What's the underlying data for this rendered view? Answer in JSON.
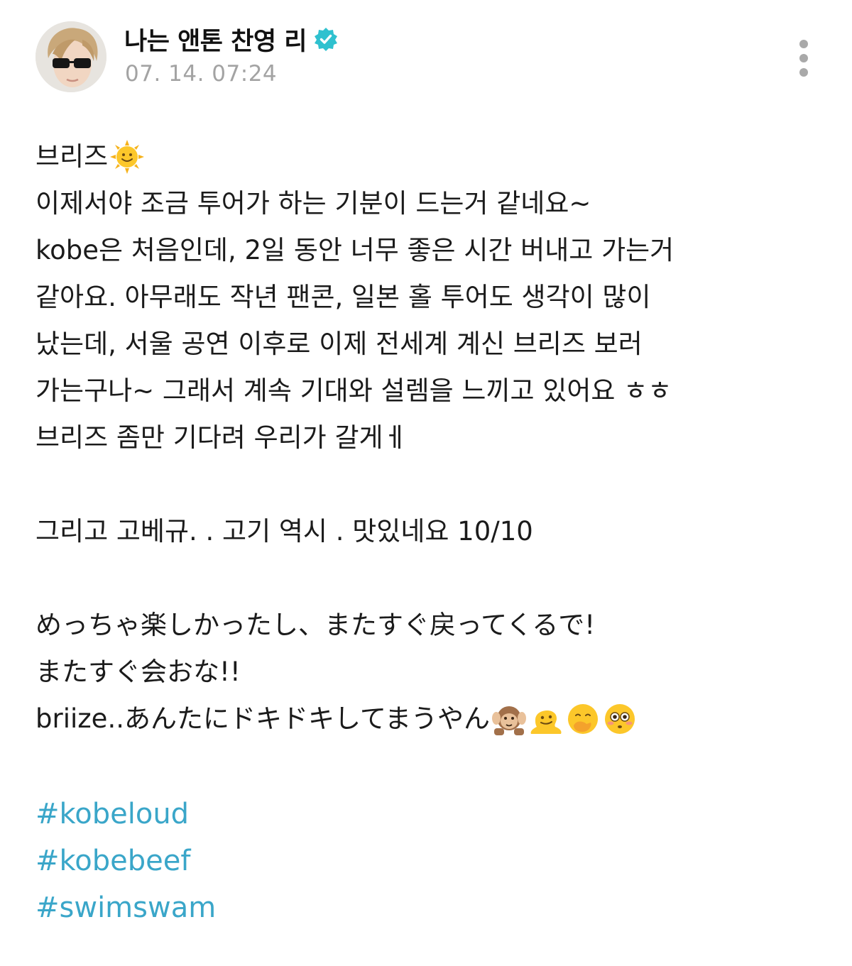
{
  "author": {
    "name": "나는 앤톤 찬영 리",
    "timestamp": "07. 14. 07:24"
  },
  "post": {
    "lines": [
      "브리즈",
      "이제서야 조금 투어가 하는 기분이 드는거 같네요~",
      "kobe은 처음인데, 2일 동안 너무 좋은 시간 버내고 가는거",
      "같아요. 아무래도 작년 팬콘, 일본 홀 투어도 생각이 많이",
      "났는데, 서울 공연 이후로 이제 전세계 계신 브리즈 보러",
      "가는구나~ 그래서 계속 기대와 설렘을 느끼고 있어요 ㅎㅎ",
      "브리즈 좀만 기다려 우리가 갈게ㅔ",
      "",
      "그리고 고베규. . 고기 역시 . 맛있네요 10/10",
      "",
      "めっちゃ楽しかったし、またすぐ戻ってくるで!",
      "またすぐ会おな!!",
      "briize..あんたにドキドキしてまうやん"
    ],
    "emojis": {
      "line1": [
        "sun-with-face-emoji"
      ],
      "line13": [
        "hear-no-evil-monkey-emoji",
        "melting-face-emoji",
        "face-with-hand-over-mouth-emoji",
        "flushed-face-emoji"
      ]
    },
    "hashtags": [
      "#kobeloud",
      "#kobebeef",
      "#swimswam"
    ]
  },
  "colors": {
    "hashtag": "#3aa6c9",
    "verified_badge": "#2fc1cf",
    "timestamp": "#a3a3a3"
  }
}
